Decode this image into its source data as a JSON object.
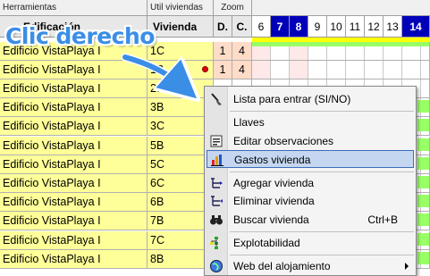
{
  "toolbar": {
    "herramientas": "Herramientas",
    "util_viviendas": "Util viviendas",
    "zoom": "Zoom"
  },
  "columns": {
    "edificio": "Edificación",
    "vivienda": "Vivienda",
    "d": "D.",
    "c": "C."
  },
  "dates": [
    "6",
    "7",
    "8",
    "9",
    "10",
    "11",
    "12",
    "13",
    "14"
  ],
  "highlighted_dates": [
    "7",
    "8",
    "14"
  ],
  "rows": [
    {
      "edificio": "Edificio VistaPlaya I",
      "vivienda": "1C",
      "d": "1",
      "c": "4"
    },
    {
      "edificio": "Edificio VistaPlaya I",
      "vivienda": "1B",
      "d": "1",
      "c": "4"
    },
    {
      "edificio": "Edificio VistaPlaya I",
      "vivienda": "2B",
      "d": "",
      "c": ""
    },
    {
      "edificio": "Edificio VistaPlaya I",
      "vivienda": "3B",
      "d": "",
      "c": ""
    },
    {
      "edificio": "Edificio VistaPlaya I",
      "vivienda": "3C",
      "d": "",
      "c": ""
    },
    {
      "edificio": "Edificio VistaPlaya I",
      "vivienda": "5B",
      "d": "",
      "c": ""
    },
    {
      "edificio": "Edificio VistaPlaya I",
      "vivienda": "5C",
      "d": "",
      "c": ""
    },
    {
      "edificio": "Edificio VistaPlaya I",
      "vivienda": "6C",
      "d": "",
      "c": ""
    },
    {
      "edificio": "Edificio VistaPlaya I",
      "vivienda": "6B",
      "d": "",
      "c": ""
    },
    {
      "edificio": "Edificio VistaPlaya I",
      "vivienda": "7B",
      "d": "",
      "c": ""
    },
    {
      "edificio": "Edificio VistaPlaya I",
      "vivienda": "7C",
      "d": "",
      "c": ""
    },
    {
      "edificio": "Edificio VistaPlaya I",
      "vivienda": "8B",
      "d": "",
      "c": ""
    }
  ],
  "callout": "Clic derecho",
  "context_menu": {
    "items": [
      {
        "label": "Lista para entrar (SI/NO)",
        "icon": "broom-icon",
        "shortcut": ""
      },
      {
        "label": "Llaves",
        "icon": "",
        "shortcut": ""
      },
      {
        "label": "Editar observaciones",
        "icon": "notes-icon",
        "shortcut": ""
      },
      {
        "label": "Gastos vivienda",
        "icon": "chart-icon",
        "shortcut": ""
      },
      {
        "label": "Agregar vivienda",
        "icon": "add-tree-icon",
        "shortcut": ""
      },
      {
        "label": "Eliminar vivienda",
        "icon": "remove-tree-icon",
        "shortcut": ""
      },
      {
        "label": "Buscar vivienda",
        "icon": "binoculars-icon",
        "shortcut": "Ctrl+B"
      },
      {
        "label": "Explotabilidad",
        "icon": "hierarchy-icon",
        "shortcut": ""
      },
      {
        "label": "Web del alojamiento",
        "icon": "globe-icon",
        "shortcut": ""
      }
    ],
    "selected": "Gastos vivienda"
  },
  "colors": {
    "name_bg": "#ffff99",
    "dc_bg": "#ffdcc8",
    "date_highlight": "#0000b8",
    "callout": "#3a8ee6",
    "menu_selection": "#c5d7f0"
  }
}
